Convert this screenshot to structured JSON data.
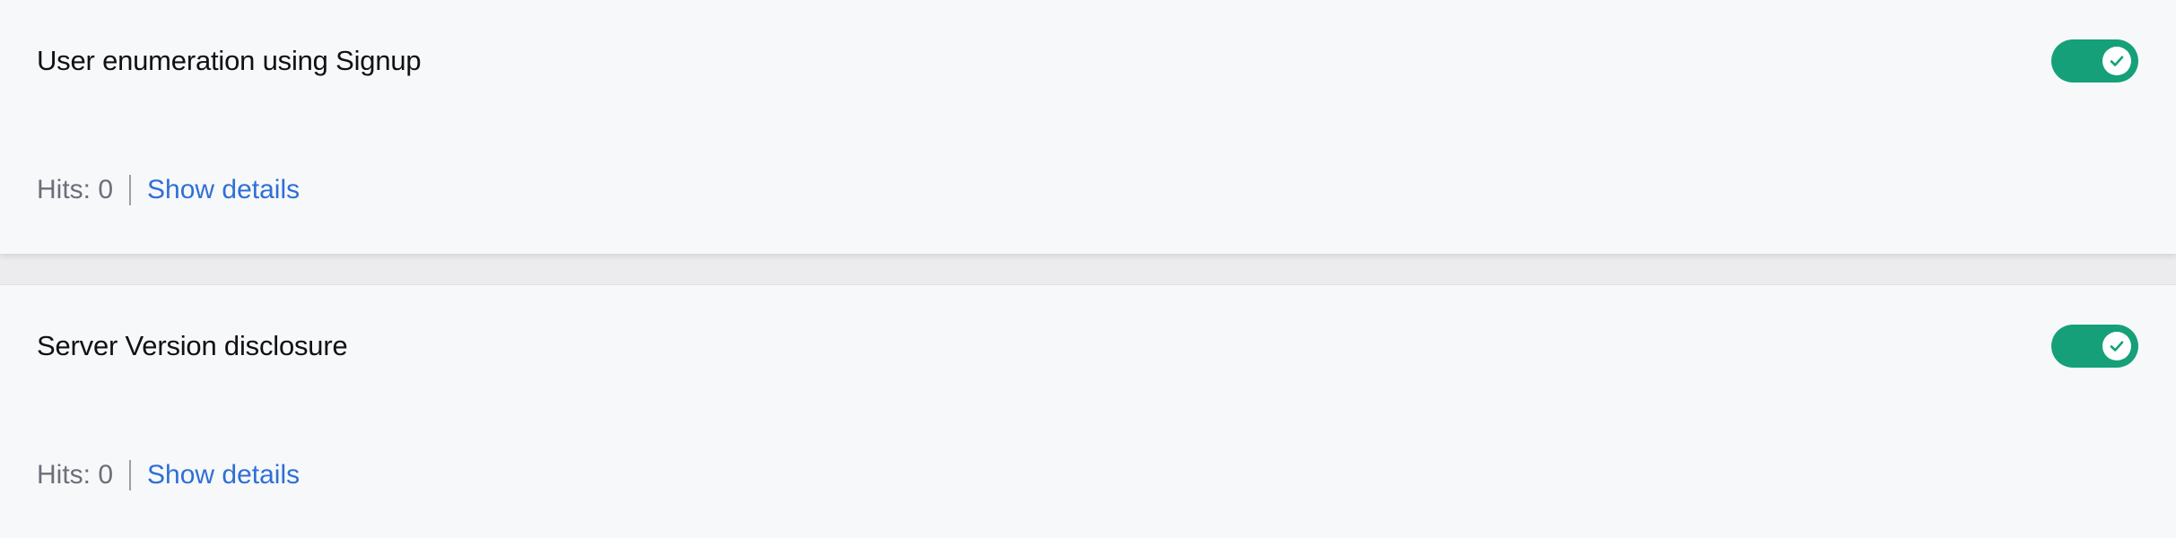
{
  "rules": [
    {
      "title": "User enumeration using Signup",
      "enabled": true,
      "hits_label": "Hits:",
      "hits_value": "0",
      "details_link": "Show details"
    },
    {
      "title": "Server Version disclosure",
      "enabled": true,
      "hits_label": "Hits:",
      "hits_value": "0",
      "details_link": "Show details"
    }
  ],
  "icons": {
    "toggle_knob": "check-icon"
  },
  "colors": {
    "toggle_on": "#15a07a",
    "link": "#2f6fd6",
    "card_background": "#f7f8fa"
  }
}
